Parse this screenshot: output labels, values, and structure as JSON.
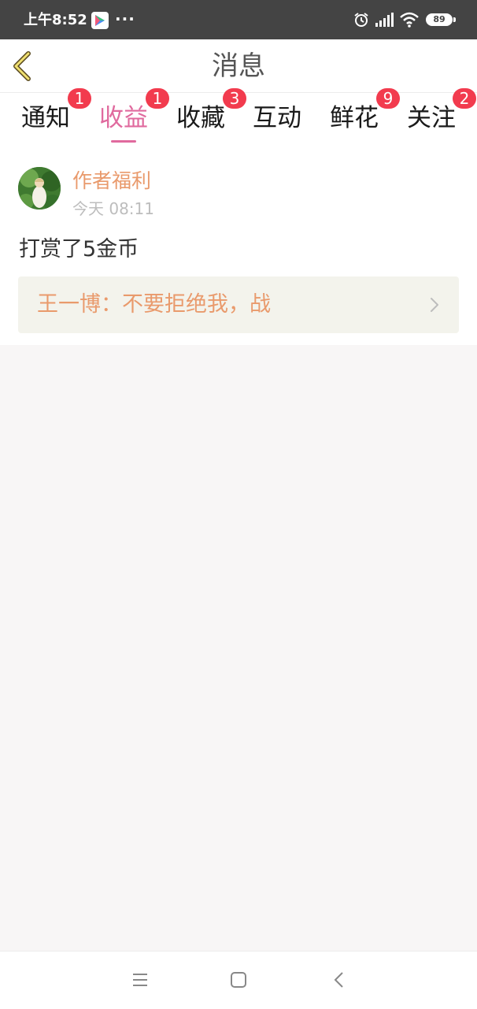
{
  "status_bar": {
    "time": "上午8:52",
    "more": "···",
    "battery": "89",
    "icons": [
      "app-store-icon",
      "alarm-icon",
      "signal-icon",
      "wifi-icon",
      "battery-icon"
    ]
  },
  "header": {
    "title": "消息",
    "back_icon": "back-chevron-icon"
  },
  "tabs": [
    {
      "label": "通知",
      "badge": "1",
      "active": false
    },
    {
      "label": "收益",
      "badge": "1",
      "active": true
    },
    {
      "label": "收藏",
      "badge": "3",
      "active": false
    },
    {
      "label": "互动",
      "badge": "",
      "active": false
    },
    {
      "label": "鲜花",
      "badge": "9",
      "active": false
    },
    {
      "label": "关注",
      "badge": "2",
      "active": false
    }
  ],
  "message": {
    "sender": "作者福利",
    "time": "今天 08:11",
    "content": "打赏了5金币",
    "link_text": "王一博：不要拒绝我，战"
  },
  "colors": {
    "accent": "#e06a9e",
    "badge": "#f23b4e",
    "sender": "#e99a6c",
    "link_bg": "#f3f3ec",
    "page_bg": "#f8f6f6"
  },
  "nav_bar": [
    "menu-icon",
    "home-icon",
    "back-icon"
  ]
}
